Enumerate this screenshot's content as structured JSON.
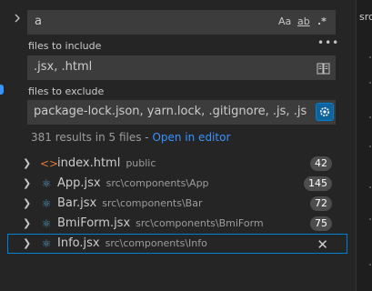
{
  "search": {
    "query": "a",
    "options": {
      "match_case": "Aa",
      "whole_word": "ab",
      "regex": ".*"
    }
  },
  "include": {
    "label": "files to include",
    "value": ".jsx, .html"
  },
  "exclude": {
    "label": "files to exclude",
    "value": "package-lock.json, yarn.lock, .gitignore, .js, .json, .y..."
  },
  "summary": {
    "text": "381 results in 5 files - ",
    "link": "Open in editor"
  },
  "results": [
    {
      "name": "index.html",
      "path": "public",
      "count": "42",
      "icon": "html-icon"
    },
    {
      "name": "App.jsx",
      "path": "src\\components\\App",
      "count": "145",
      "icon": "react-icon"
    },
    {
      "name": "Bar.jsx",
      "path": "src\\components\\Bar",
      "count": "72",
      "icon": "react-icon"
    },
    {
      "name": "BmiForm.jsx",
      "path": "src\\components\\BmiForm",
      "count": "75",
      "icon": "react-icon"
    },
    {
      "name": "Info.jsx",
      "path": "src\\components\\Info",
      "count": "",
      "icon": "react-icon"
    }
  ],
  "right_tab": "src",
  "colors": {
    "accent": "#007fd4",
    "link": "#3794ff",
    "react": "#519aba",
    "html": "#e37933"
  }
}
